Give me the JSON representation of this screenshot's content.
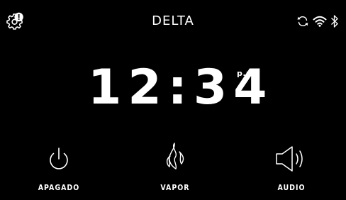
{
  "header": {
    "title": "DELTA",
    "settings_icon": "gear-alert-icon",
    "status_icons": [
      "sync-icon",
      "wifi-icon",
      "bluetooth-icon"
    ]
  },
  "clock": {
    "time": "12:34",
    "period": "p.m."
  },
  "controls": [
    {
      "label": "APAGADO",
      "icon": "power-icon"
    },
    {
      "label": "VAPOR",
      "icon": "steam-icon"
    },
    {
      "label": "AUDIO",
      "icon": "speaker-icon"
    }
  ],
  "colors": {
    "background": "#000000",
    "foreground": "#ffffff"
  }
}
